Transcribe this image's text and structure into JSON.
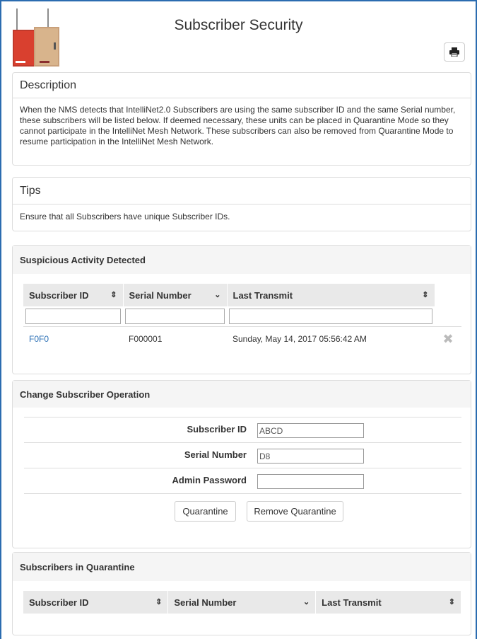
{
  "page": {
    "title": "Subscriber Security"
  },
  "header": {
    "print_icon": "print-icon",
    "logo_icon": "device-enclosures-image"
  },
  "description": {
    "heading": "Description",
    "body": "When the NMS detects that IntelliNet2.0 Subscribers are using the same subscriber ID and the same Serial number, these subscribers will be listed below. If deemed necessary, these units can be placed in Quarantine Mode so they cannot participate in the IntelliNet Mesh Network. These subscribers can also be removed from Quarantine Mode to resume participation in the IntelliNet Mesh Network."
  },
  "tips": {
    "heading": "Tips",
    "body": "Ensure that all Subscribers have unique Subscriber IDs."
  },
  "suspicious": {
    "heading": "Suspicious Activity Detected",
    "columns": [
      "Subscriber ID",
      "Serial Number",
      "Last Transmit"
    ],
    "rows": [
      {
        "subscriber_id": "F0F0",
        "serial": "F000001",
        "last_transmit": "Sunday, May 14, 2017 05:56:42 AM"
      }
    ]
  },
  "change": {
    "heading": "Change Subscriber Operation",
    "subscriber_id_label": "Subscriber ID",
    "subscriber_id_value": "ABCD",
    "serial_label": "Serial Number",
    "serial_value": "D8",
    "password_label": "Admin Password",
    "password_value": "",
    "quarantine_button": "Quarantine",
    "remove_button": "Remove Quarantine"
  },
  "quarantine": {
    "heading": "Subscribers in Quarantine",
    "columns": [
      "Subscriber ID",
      "Serial Number",
      "Last Transmit"
    ]
  }
}
